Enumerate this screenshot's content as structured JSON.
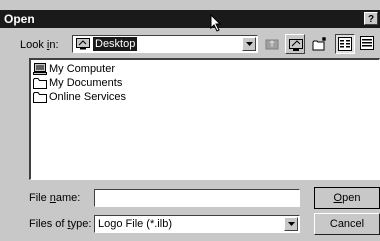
{
  "window": {
    "title": "Open",
    "help_label": "?"
  },
  "lookin": {
    "label_pre": "Look ",
    "label_accel": "i",
    "label_post": "n:",
    "value": "Desktop",
    "icon": "desktop-icon"
  },
  "toolbar": [
    {
      "name": "up-one-level-button",
      "icon": "up-folder-icon"
    },
    {
      "name": "desktop-button",
      "icon": "desktop-icon"
    },
    {
      "name": "new-folder-button",
      "icon": "new-folder-icon"
    },
    {
      "name": "list-view-button",
      "icon": "list-view-icon"
    },
    {
      "name": "details-view-button",
      "icon": "details-view-icon"
    }
  ],
  "files": [
    {
      "label": "My Computer",
      "icon": "computer-icon"
    },
    {
      "label": "My Documents",
      "icon": "folder-icon"
    },
    {
      "label": "Online Services",
      "icon": "folder-icon"
    }
  ],
  "filename": {
    "label_pre": "File ",
    "label_accel": "n",
    "label_post": "ame:",
    "value": ""
  },
  "filetype": {
    "label_pre": "Files of ",
    "label_accel": "t",
    "label_post": "ype:",
    "value": "Logo File (*.ilb)"
  },
  "buttons": {
    "open_accel": "O",
    "open_rest": "pen",
    "cancel": "Cancel"
  }
}
